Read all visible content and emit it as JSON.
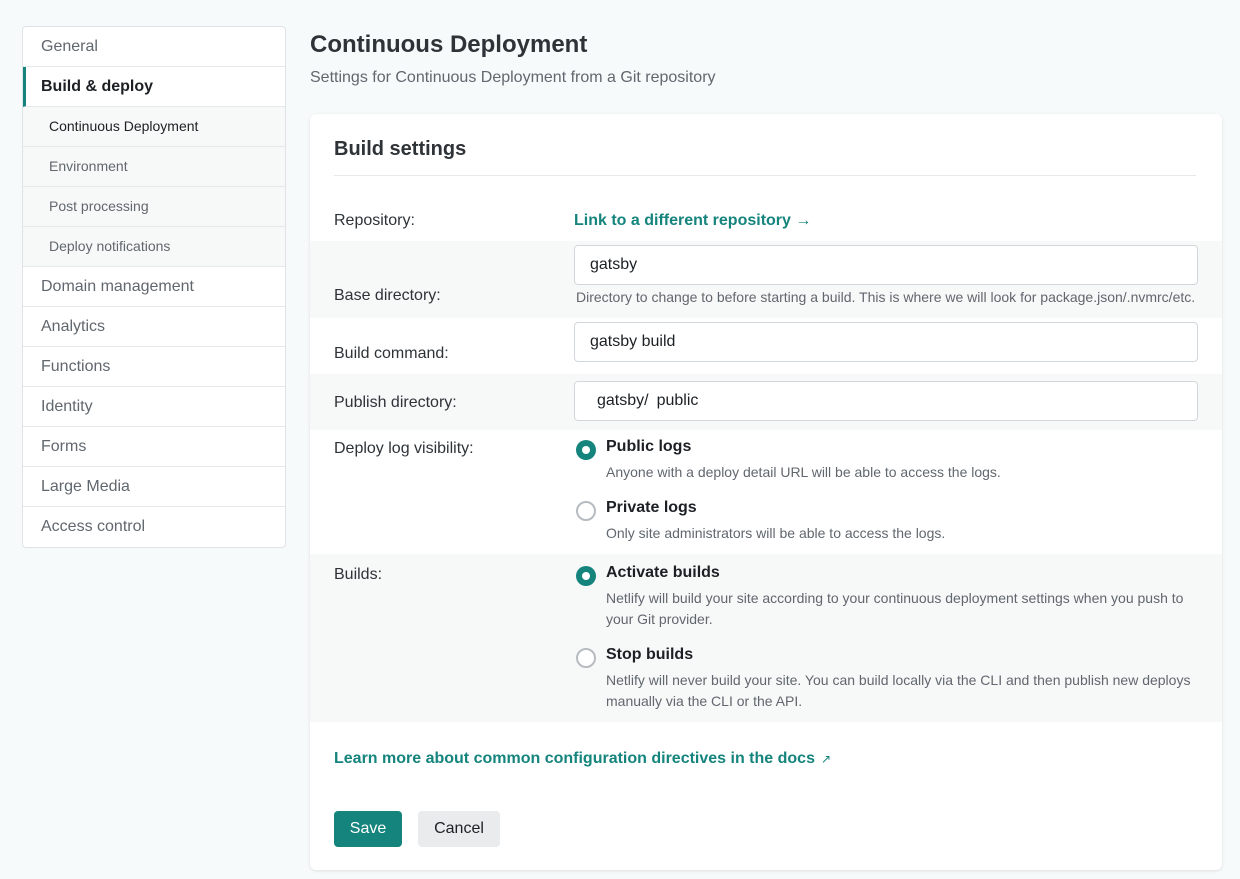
{
  "sidebar": {
    "items": [
      {
        "label": "General"
      },
      {
        "label": "Build & deploy"
      },
      {
        "label": "Domain management"
      },
      {
        "label": "Analytics"
      },
      {
        "label": "Functions"
      },
      {
        "label": "Identity"
      },
      {
        "label": "Forms"
      },
      {
        "label": "Large Media"
      },
      {
        "label": "Access control"
      }
    ],
    "subitems": [
      {
        "label": "Continuous Deployment"
      },
      {
        "label": "Environment"
      },
      {
        "label": "Post processing"
      },
      {
        "label": "Deploy notifications"
      }
    ]
  },
  "header": {
    "title": "Continuous Deployment",
    "subtitle": "Settings for Continuous Deployment from a Git repository"
  },
  "card": {
    "title": "Build settings",
    "repository": {
      "label": "Repository:",
      "link": "Link to a different repository →"
    },
    "base_directory": {
      "label": "Base directory:",
      "value": "gatsby",
      "help": "Directory to change to before starting a build. This is where we will look for package.json/.nvmrc/etc."
    },
    "build_command": {
      "label": "Build command:",
      "value": "gatsby build"
    },
    "publish_directory": {
      "label": "Publish directory:",
      "prefix": "gatsby/",
      "value": "public"
    },
    "deploy_log": {
      "label": "Deploy log visibility:",
      "options": [
        {
          "title": "Public logs",
          "desc": "Anyone with a deploy detail URL will be able to access the logs.",
          "checked": true
        },
        {
          "title": "Private logs",
          "desc": "Only site administrators will be able to access the logs.",
          "checked": false
        }
      ]
    },
    "builds": {
      "label": "Builds:",
      "options": [
        {
          "title": "Activate builds",
          "desc": "Netlify will build your site according to your continuous deployment settings when you push to your Git provider.",
          "checked": true
        },
        {
          "title": "Stop builds",
          "desc": "Netlify will never build your site. You can build locally via the CLI and then publish new deploys manually via the CLI or the API.",
          "checked": false
        }
      ]
    },
    "docs_link": "Learn more about common configuration directives in the docs",
    "docs_link_icon": "↗",
    "save_label": "Save",
    "cancel_label": "Cancel"
  }
}
